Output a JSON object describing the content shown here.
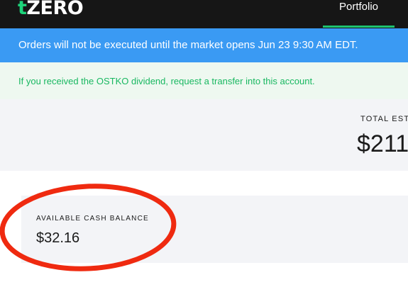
{
  "header": {
    "logo_prefix": "t",
    "logo_text": "ZERO",
    "nav_tab": "Portfolio"
  },
  "banners": {
    "market_notice": "Orders will not be executed until the market opens Jun 23 9:30 AM EDT.",
    "dividend_notice": "If you received the OSTKO dividend, request a transfer into this account."
  },
  "total": {
    "label": "TOTAL EST",
    "value": "$211"
  },
  "cash": {
    "label": "AVAILABLE CASH BALANCE",
    "value": "$32.16"
  },
  "colors": {
    "brand_green": "#1dd47a",
    "banner_blue": "#3a9af3",
    "annotation_red": "#ef2a10"
  }
}
